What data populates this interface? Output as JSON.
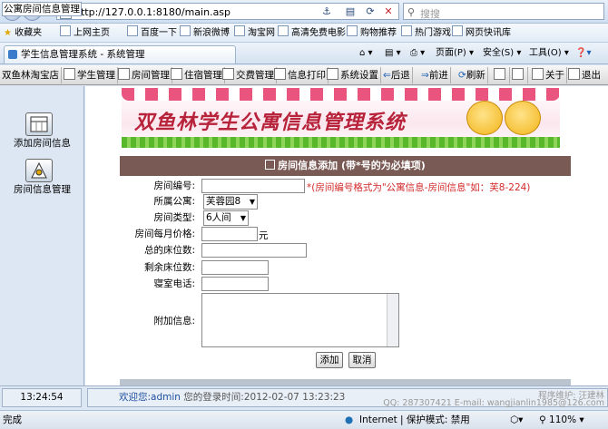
{
  "browser": {
    "url": "http://127.0.0.1:8180/main.asp",
    "search_placeholder": "搜搜",
    "favorites_label": "收藏夹",
    "favorites": [
      "上网主页",
      "百度一下",
      "新浪微博",
      "淘宝网",
      "高清免费电影",
      "购物推荐",
      "热门游戏",
      "网页快讯库"
    ],
    "tab_title": "学生信息管理系统 - 系统管理",
    "tools": [
      "页面(P)",
      "安全(S)",
      "工具(O)"
    ],
    "status_left": "完成",
    "zone": "Internet | 保护模式: 禁用",
    "zoom": "110%"
  },
  "app": {
    "menu": [
      "双鱼林淘宝店",
      "学生管理",
      "房间管理",
      "住宿管理",
      "交费管理",
      "信息打印",
      "系统设置",
      "后退",
      "前进",
      "刷新",
      "关于",
      "退出"
    ],
    "left_panel": {
      "header": "公寓房间信息管理",
      "items": [
        "添加房间信息",
        "房间信息管理"
      ]
    },
    "banner_title": "双鱼林学生公寓信息管理系统",
    "form": {
      "title": "房间信息添加",
      "title_note": "(带*号的为必填项)",
      "room_no_label": "房间编号:",
      "room_no_hint": "*(房间编号格式为\"公寓信息-房间信息\"如：芙8-224)",
      "building_label": "所属公寓:",
      "building_value": "芙蓉园8",
      "type_label": "房间类型:",
      "type_value": "6人间",
      "price_label": "房间每月价格:",
      "price_unit": "元",
      "total_beds_label": "总的床位数:",
      "remaining_beds_label": "剩余床位数:",
      "phone_label": "寝室电话:",
      "extra_label": "附加信息:",
      "add_button": "添加",
      "cancel_button": "取消"
    },
    "footer": {
      "clock": "13:24:54",
      "welcome_prefix": "欢迎您:",
      "user": "admin",
      "login_time": "您的登录时间:2012-02-07 13:23:23",
      "maint": "程序维护: 汪建林",
      "contact": "QQ: 287307421 E-mail: wangjianlin1985@126.com"
    }
  }
}
